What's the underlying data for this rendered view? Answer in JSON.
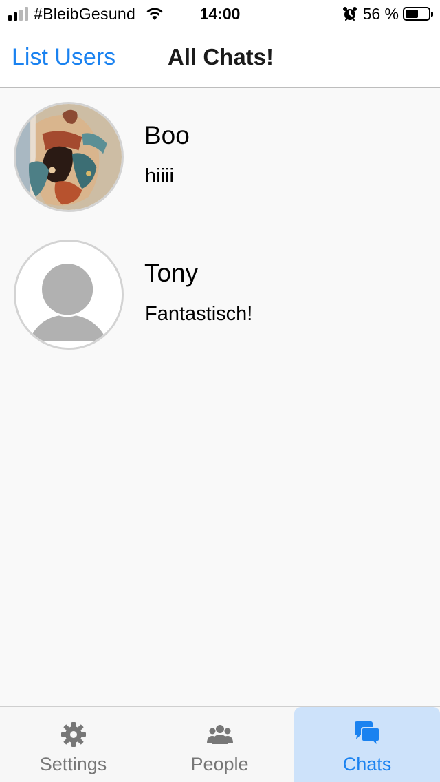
{
  "status_bar": {
    "carrier": "#BleibGesund",
    "time": "14:00",
    "battery_percent": "56 %",
    "battery_level": 0.56,
    "signal_bars_active": 2,
    "signal_bars_total": 4
  },
  "nav": {
    "left_button": "List Users",
    "title": "All Chats!"
  },
  "chats": [
    {
      "name": "Boo",
      "last_message": "hiiii",
      "avatar": "photo-avatar"
    },
    {
      "name": "Tony",
      "last_message": "Fantastisch!",
      "avatar": "default-person-avatar"
    }
  ],
  "tabs": [
    {
      "label": "Settings",
      "icon": "gear-icon",
      "active": false
    },
    {
      "label": "People",
      "icon": "people-icon",
      "active": false
    },
    {
      "label": "Chats",
      "icon": "chat-bubbles-icon",
      "active": true
    }
  ],
  "colors": {
    "accent": "#1a82f0",
    "active_tab_background": "#cde2fa",
    "inactive_tab": "#777777",
    "list_background": "#f9f9f9"
  }
}
